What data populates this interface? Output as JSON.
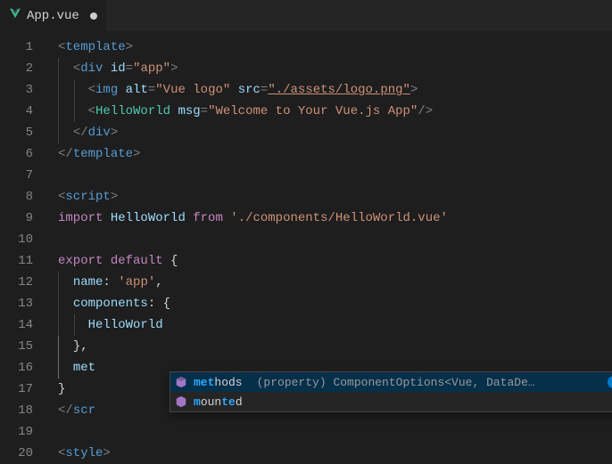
{
  "tab": {
    "filename": "App.vue",
    "dirty": true
  },
  "icons": {
    "vue": "vue-logo-icon",
    "cube": "cube-icon",
    "info": "info-icon"
  },
  "code": {
    "attrs": {
      "id": "id",
      "alt": "alt",
      "src": "src",
      "msg": "msg"
    },
    "tags": {
      "template": "template",
      "div": "div",
      "img": "img",
      "script": "script",
      "style": "style"
    },
    "components": {
      "HelloWorld": "HelloWorld"
    },
    "strings": {
      "app": "\"app\"",
      "vuelogo": "\"Vue logo\"",
      "logosrc": "\"./assets/logo.png\"",
      "welcome": "\"Welcome to Your Vue.js App\"",
      "hwpath": "'./components/HelloWorld.vue'",
      "appname": "'app'"
    },
    "keywords": {
      "import": "import",
      "from": "from",
      "export": "export",
      "default": "default"
    },
    "props": {
      "name": "name",
      "components": "components",
      "met": "met"
    }
  },
  "suggest": {
    "items": [
      {
        "label_pre": "met",
        "label_post": "hods",
        "detail": "(property) ComponentOptions<Vue, DataDe…",
        "selected": true,
        "info": true
      },
      {
        "label_pre": "m",
        "label_mid": "oun",
        "label_hl2": "te",
        "label_post": "d",
        "detail": "",
        "selected": false,
        "info": false
      }
    ]
  },
  "lineCount": 20
}
